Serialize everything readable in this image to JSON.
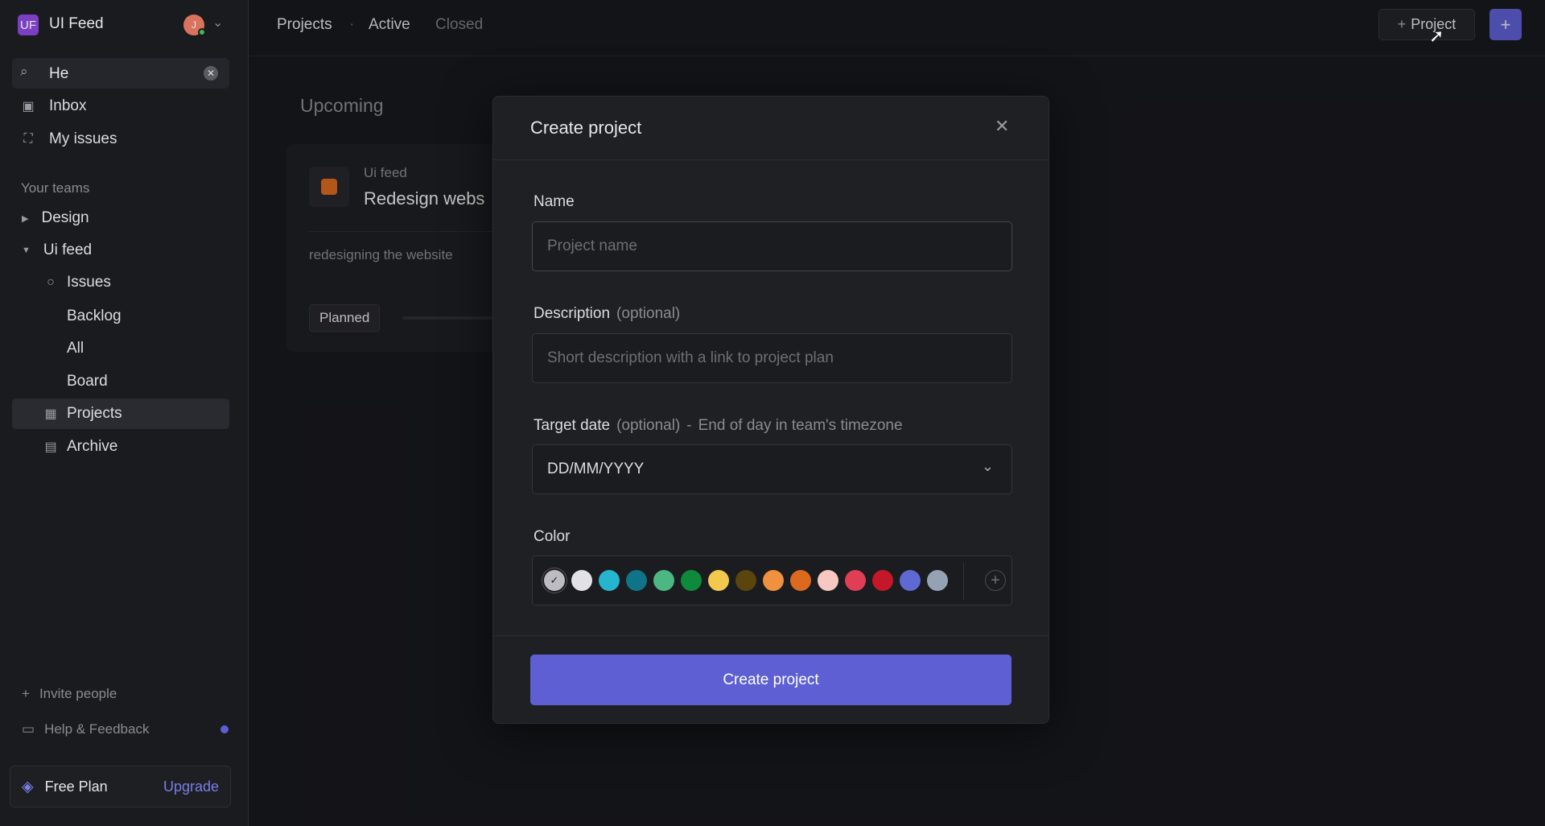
{
  "workspace": {
    "initials": "UF",
    "name": "UI Feed",
    "avatar_initial": "J"
  },
  "search": {
    "value": "He"
  },
  "nav": {
    "inbox": "Inbox",
    "my_issues": "My issues"
  },
  "teams": {
    "heading": "Your teams",
    "design": "Design",
    "ui_feed": "Ui feed",
    "issues": "Issues",
    "backlog": "Backlog",
    "all": "All",
    "board": "Board",
    "projects": "Projects",
    "archive": "Archive"
  },
  "footer": {
    "invite": "Invite people",
    "help": "Help & Feedback",
    "plan": "Free Plan",
    "upgrade": "Upgrade"
  },
  "header": {
    "tabs": [
      "Projects",
      "Active",
      "Closed"
    ],
    "project_button": "Project"
  },
  "main": {
    "section": "Upcoming",
    "card": {
      "team": "Ui feed",
      "title": "Redesign webs",
      "description": "redesigning the website",
      "status": "Planned"
    }
  },
  "modal": {
    "title": "Create project",
    "name_label": "Name",
    "name_placeholder": "Project name",
    "description_label": "Description",
    "optional": "(optional)",
    "description_placeholder": "Short description with a link to project plan",
    "target_label": "Target date",
    "target_hint": "End of day in team's timezone",
    "target_value": "DD/MM/YYYY",
    "color_label": "Color",
    "colors": [
      "#bcbcc2",
      "#e2e2e6",
      "#26b5ce",
      "#0f7488",
      "#4cb782",
      "#0e8a3c",
      "#f2c94c",
      "#5a450d",
      "#f0913f",
      "#db6a1f",
      "#f7c8c1",
      "#e03e55",
      "#c41729",
      "#5e6ad2",
      "#95a2b3"
    ],
    "selected_color": "#bcbcc2",
    "submit": "Create project"
  },
  "accent": "#5e5fd2"
}
